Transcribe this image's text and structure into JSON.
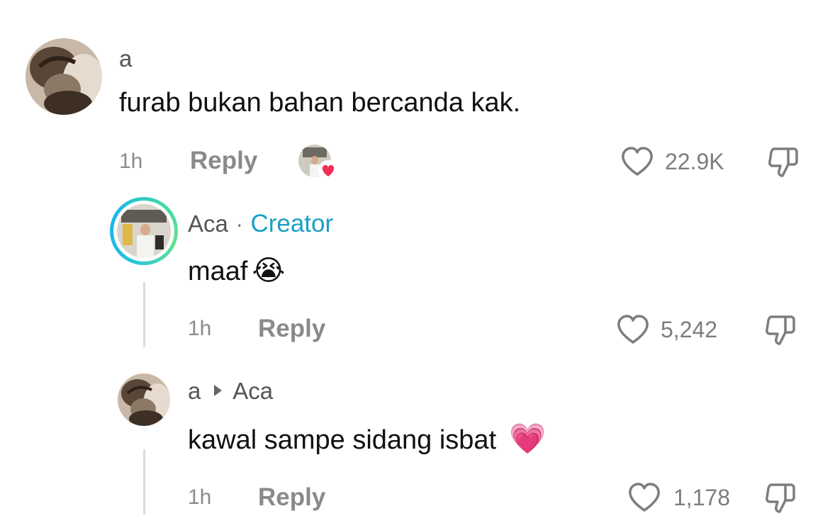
{
  "comments": [
    {
      "username": "a",
      "text": "furab bukan bahan bercanda kak.",
      "time": "1h",
      "reply_label": "Reply",
      "likes": "22.9K"
    },
    {
      "username": "Aca",
      "separator": "·",
      "badge": "Creator",
      "text": "maaf",
      "emoji": "😭",
      "time": "1h",
      "reply_label": "Reply",
      "likes": "5,242"
    },
    {
      "username": "a",
      "reply_to": "Aca",
      "text": "kawal sampe sidang isbat",
      "emoji": "💗",
      "time": "1h",
      "reply_label": "Reply",
      "likes": "1,178"
    }
  ],
  "colors": {
    "creator_accent": "#19a0c4",
    "liked_heart": "#f23057",
    "muted_text": "#8a8a8a"
  },
  "icons": [
    "heart-outline-icon",
    "dislike-icon",
    "creator-liked-heart-icon",
    "reply-arrow-icon"
  ]
}
